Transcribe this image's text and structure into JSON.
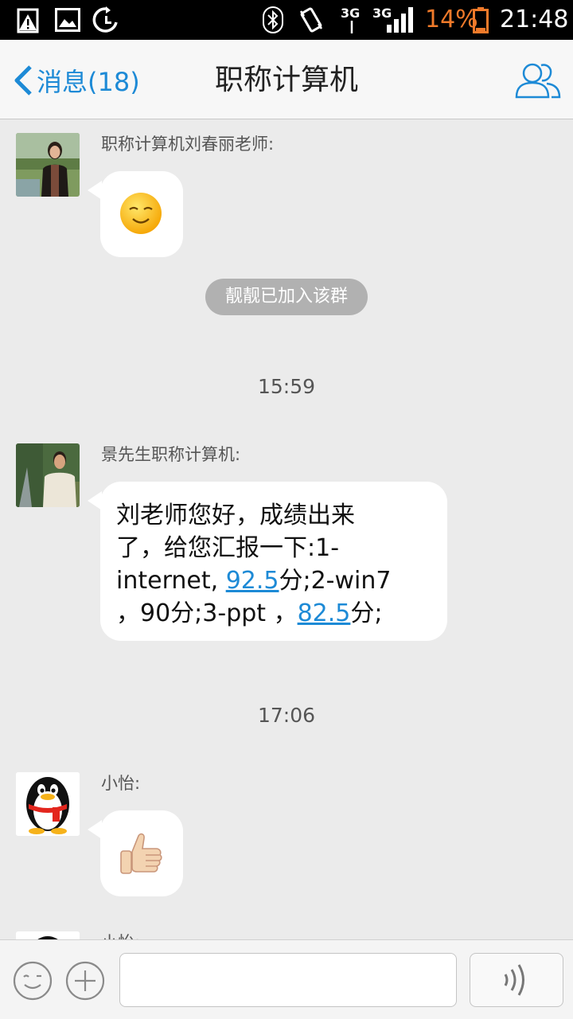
{
  "status_bar": {
    "signal_label": "3G",
    "signal_label_2": "3G",
    "battery_percent": "14%",
    "time": "21:48"
  },
  "nav": {
    "back_label": "消息(18)",
    "title": "职称计算机"
  },
  "messages": [
    {
      "sender": "职称计算机刘春丽老师:",
      "content_icon": "smile-emoji"
    },
    {
      "system_notice": "靓靓已加入该群"
    },
    {
      "timestamp": "15:59"
    },
    {
      "sender": "景先生职称计算机:",
      "text_parts": {
        "line1": "刘老师您好，成绩出来",
        "line2": "了，给您汇报一下:1-",
        "line3_a": "internet, ",
        "line3_link": "92.5",
        "line3_b": "分;2-win7",
        "line4_a": "，90分;3-ppt ，",
        "line4_link": "82.5",
        "line4_b": "分;"
      }
    },
    {
      "timestamp": "17:06"
    },
    {
      "sender": "小怡:",
      "content_icon": "thumbs-up-emoji"
    },
    {
      "sender": "小怡:"
    }
  ],
  "colors": {
    "accent": "#1d8ad6",
    "chat_background": "#ebebeb",
    "battery_low": "#f07a2a"
  }
}
